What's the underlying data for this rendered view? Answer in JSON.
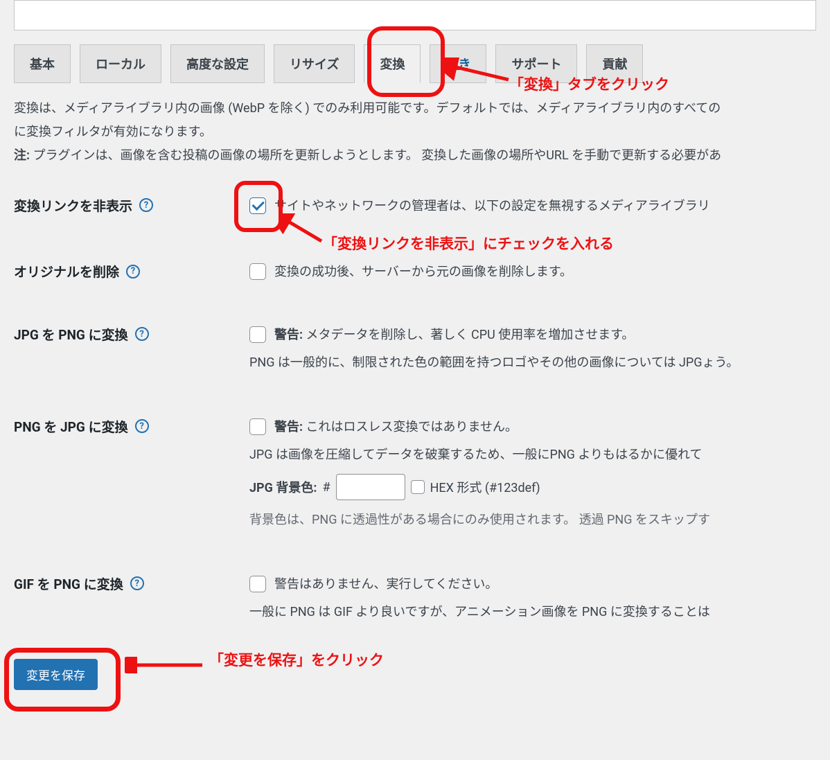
{
  "tabs": {
    "basic": "基本",
    "local": "ローカル",
    "advanced": "高度な設定",
    "resize": "リサイズ",
    "convert": "変換",
    "overwrite": "書き",
    "support": "サポート",
    "contribute": "貢献"
  },
  "description": {
    "line1": "変換は、メディアライブラリ内の画像 (WebP を除く) でのみ利用可能です。デフォルトでは、メディアライブラリ内のすべての",
    "line2": "に変換フィルタが有効になります。",
    "note_label": "注:",
    "note_text": " プラグインは、画像を含む投稿の画像の場所を更新しようとします。 変換した画像の場所やURL を手動で更新する必要があ"
  },
  "settings": {
    "hide_convert_links": {
      "label": "変換リンクを非表示",
      "text": "サイトやネットワークの管理者は、以下の設定を無視するメディアライブラリ"
    },
    "delete_original": {
      "label": "オリジナルを削除",
      "text": "変換の成功後、サーバーから元の画像を削除します。"
    },
    "jpg_to_png": {
      "label": "JPG を PNG に変換",
      "warn_label": "警告:",
      "warn_text": " メタデータを削除し、著しく CPU 使用率を増加させます。",
      "sub": "PNG は一般的に、制限された色の範囲を持つロゴやその他の画像については JPGょう。"
    },
    "png_to_jpg": {
      "label": "PNG を JPG に変換",
      "warn_label": "警告:",
      "warn_text": " これはロスレス変換ではありません。",
      "sub": "JPG は画像を圧縮してデータを破棄するため、一般にPNG よりもはるかに優れて",
      "bg_label": "JPG 背景色:",
      "bg_hash": " #",
      "hex_label": "HEX 形式 (#123def)",
      "bg_note": "背景色は、PNG に透過性がある場合にのみ使用されます。 透過 PNG をスキップす"
    },
    "gif_to_png": {
      "label": "GIF を PNG に変換",
      "text": "警告はありません、実行してください。",
      "sub": "一般に PNG は GIF より良いですが、アニメーション画像を PNG に変換することは"
    }
  },
  "save_button": "変更を保存",
  "annotations": {
    "tab": "「変換」タブをクリック",
    "checkbox": "「変換リンクを非表示」にチェックを入れる",
    "save": "「変更を保存」をクリック"
  }
}
